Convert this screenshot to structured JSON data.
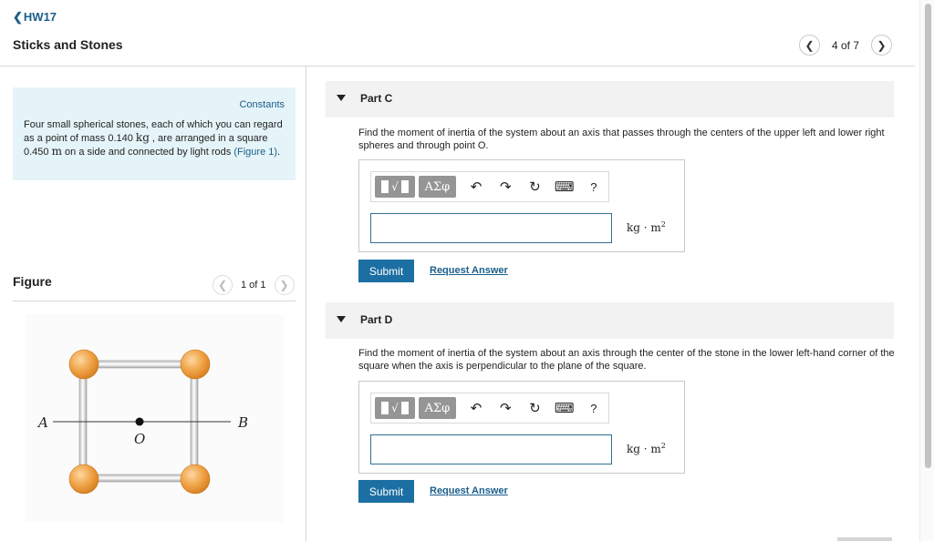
{
  "header": {
    "back_label": "HW17",
    "assignment_title": "Sticks and Stones",
    "pager": "4 of 7"
  },
  "problem": {
    "constants_label": "Constants",
    "text_1": "Four small spherical stones, each of which you can regard as a point of mass 0.140 ",
    "unit_kg": "kg",
    "text_2": " , are arranged in a square 0.450 ",
    "unit_m": "m",
    "text_3": " on a side and connected by light rods ",
    "figure_link": "(Figure 1)",
    "text_4": "."
  },
  "figure": {
    "label": "Figure",
    "pager": "1 of 1",
    "label_a": "A",
    "label_b": "B",
    "label_o": "O"
  },
  "parts": [
    {
      "title": "Part C",
      "question": "Find the moment of inertia of the system about an axis that passes through the centers of the upper left and lower right spheres and through point O.",
      "unit": "kg · m",
      "unit_exp": "2",
      "submit_label": "Submit",
      "request_label": "Request Answer"
    },
    {
      "title": "Part D",
      "question": "Find the moment of inertia of the system about an axis through the center of the stone in the lower left-hand corner of the square when the axis is perpendicular to the plane of the square.",
      "unit": "kg · m",
      "unit_exp": "2",
      "submit_label": "Submit",
      "request_label": "Request Answer"
    }
  ],
  "toolbar": {
    "template_root": "√",
    "greek_label": "ΑΣφ",
    "undo_icon": "undo-arrow-icon",
    "redo_icon": "redo-arrow-icon",
    "reset_icon": "reset-icon",
    "keyboard_icon": "keyboard-icon",
    "help_label": "?"
  },
  "colors": {
    "accent": "#1c6fa3",
    "link": "#1a5e8a",
    "constants_bg": "#e5f4f8",
    "sphere": "#f0a347"
  }
}
